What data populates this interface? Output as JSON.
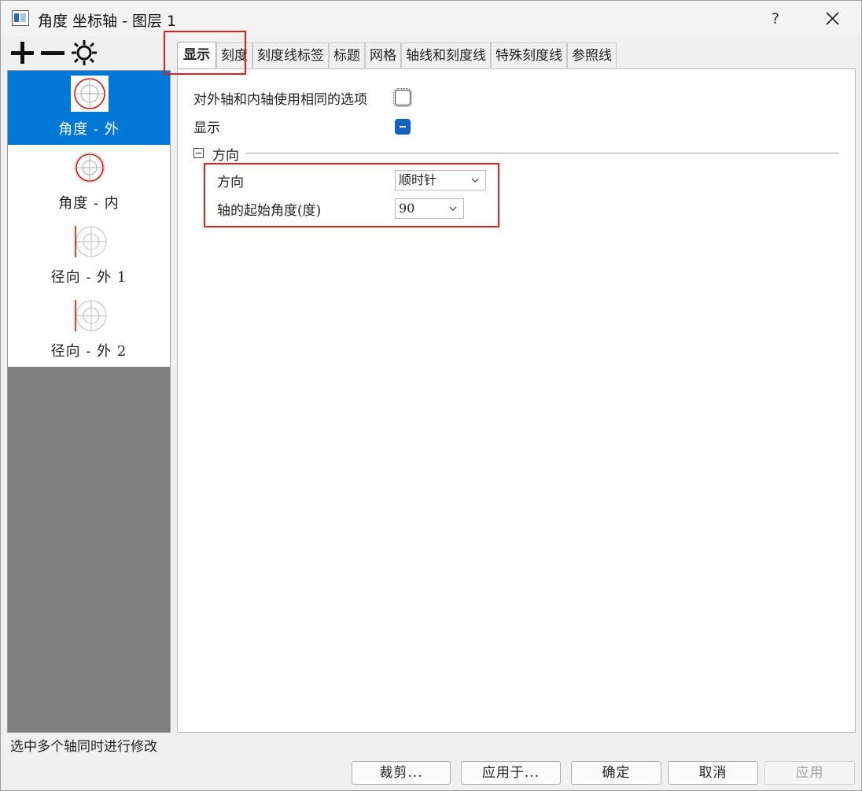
{
  "window": {
    "title": "角度 坐标轴 - 图层 1",
    "help_label": "?"
  },
  "axes": [
    {
      "label": "角度 - 外",
      "selected": true
    },
    {
      "label": "角度 - 内",
      "selected": false
    },
    {
      "label": "径向 - 外 1",
      "selected": false
    },
    {
      "label": "径向 - 外 2",
      "selected": false
    }
  ],
  "tabs": [
    "显示",
    "刻度",
    "刻度线标签",
    "标题",
    "网格",
    "轴线和刻度线",
    "特殊刻度线",
    "参照线"
  ],
  "content": {
    "same_options_label": "对外轴和内轴使用相同的选项",
    "show_label": "显示",
    "direction_group": "方向",
    "direction_label": "方向",
    "direction_value": "顺时针",
    "start_angle_label": "轴的起始角度(度)",
    "start_angle_value": "90"
  },
  "status_text": "选中多个轴同时进行修改",
  "buttons": {
    "crop": "裁剪...",
    "apply_to": "应用于...",
    "ok": "确定",
    "cancel": "取消",
    "apply": "应用"
  },
  "colors": {
    "selection": "#0078d7",
    "highlight_box": "#e02020",
    "left_panel_bg": "#808080"
  }
}
